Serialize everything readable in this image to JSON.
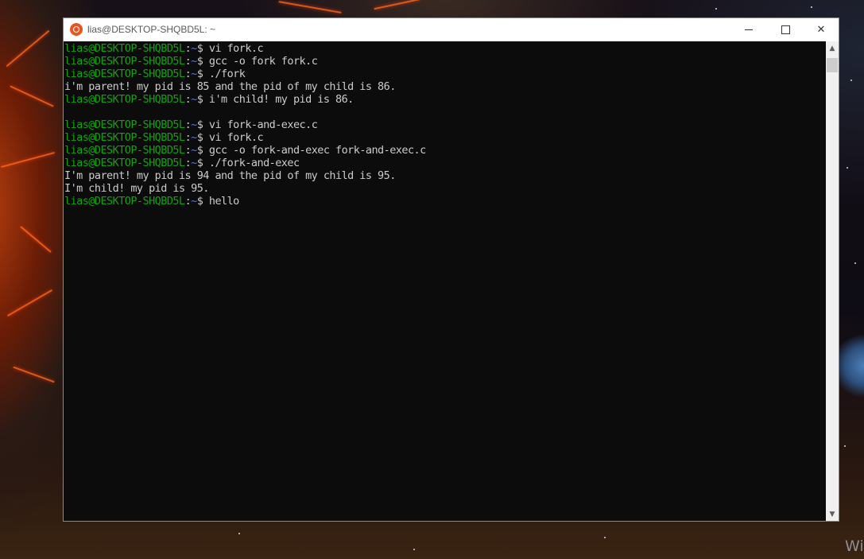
{
  "window": {
    "title": "lias@DESKTOP-SHQBD5L: ~",
    "controls": {
      "minimize_icon": "minimize-icon",
      "maximize_icon": "maximize-icon",
      "close_icon": "close-icon"
    }
  },
  "terminal": {
    "colors": {
      "background": "#0c0c0c",
      "text": "#cccccc",
      "prompt_user": "#13a10e",
      "prompt_path": "#3b78ff"
    },
    "prompt": {
      "user_host": "lias@DESKTOP-SHQBD5L",
      "separator": ":",
      "path": "~",
      "symbol": "$ "
    },
    "lines": [
      {
        "type": "prompt",
        "command": "vi fork.c"
      },
      {
        "type": "prompt",
        "command": "gcc -o fork fork.c"
      },
      {
        "type": "prompt",
        "command": "./fork"
      },
      {
        "type": "output",
        "text": "i'm parent! my pid is 85 and the pid of my child is 86."
      },
      {
        "type": "prompt",
        "command": "i'm child! my pid is 86."
      },
      {
        "type": "output",
        "text": ""
      },
      {
        "type": "prompt",
        "command": "vi fork-and-exec.c"
      },
      {
        "type": "prompt",
        "command": "vi fork.c"
      },
      {
        "type": "prompt",
        "command": "gcc -o fork-and-exec fork-and-exec.c"
      },
      {
        "type": "prompt",
        "command": "./fork-and-exec"
      },
      {
        "type": "output",
        "text": "I'm parent! my pid is 94 and the pid of my child is 95."
      },
      {
        "type": "output",
        "text": "I'm child! my pid is 95."
      },
      {
        "type": "prompt",
        "command": "hello"
      }
    ]
  },
  "desktop": {
    "watermark_text": "Wi"
  }
}
